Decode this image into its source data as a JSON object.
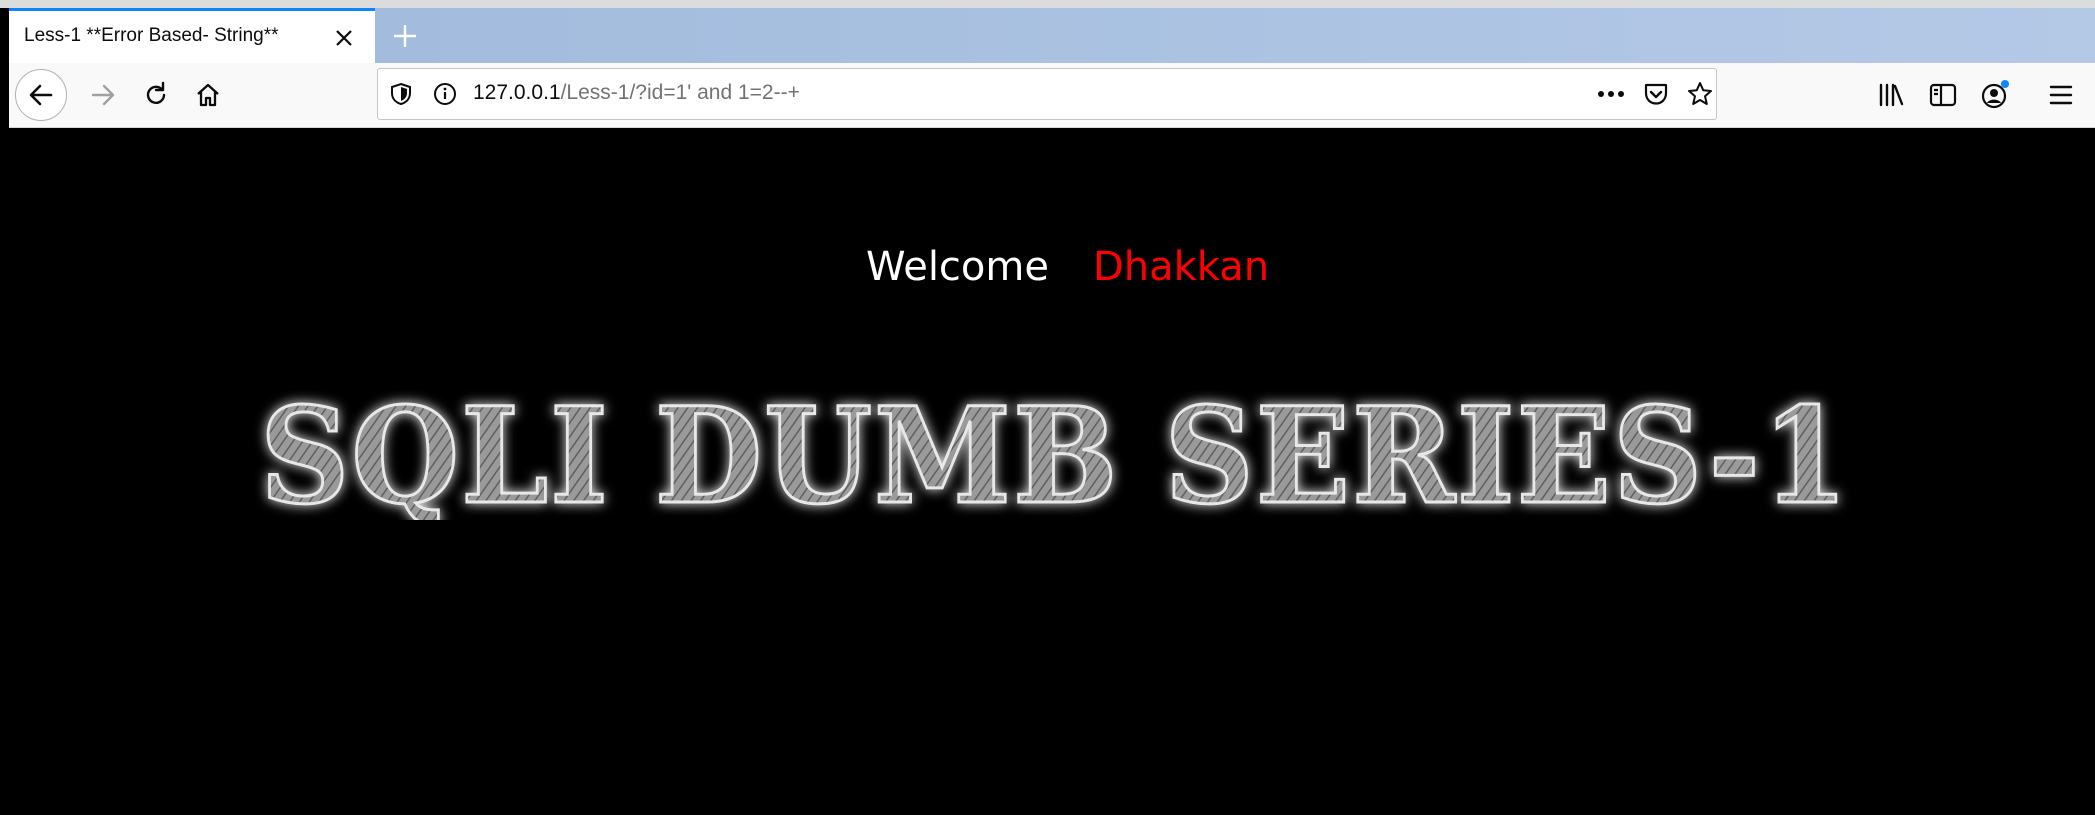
{
  "browser": {
    "tab": {
      "title": "Less-1 **Error Based- String**",
      "close_icon": "close-icon"
    },
    "new_tab_icon": "plus-icon",
    "nav": {
      "back_icon": "back-arrow-icon",
      "forward_icon": "forward-arrow-icon",
      "reload_icon": "reload-icon",
      "home_icon": "home-icon"
    },
    "urlbar": {
      "host": "127.0.0.1",
      "path": "/Less-1/?id=1' and 1=2--+",
      "shield_icon": "tracking-shield-icon",
      "info_icon": "info-icon",
      "more_icon": "more-dots-icon",
      "pocket_icon": "pocket-icon",
      "bookmark_icon": "star-icon"
    },
    "toolbar": {
      "library_icon": "library-icon",
      "sidebar_icon": "sidebar-icon",
      "account_icon": "account-icon",
      "menu_icon": "hamburger-menu-icon"
    },
    "colors": {
      "tab_accent": "#0a84ff",
      "notification_dot": "#0a84ff"
    }
  },
  "page": {
    "welcome_label": "Welcome",
    "welcome_name": "Dhakkan",
    "banner_text": "SQLI DUMB SERIES-1",
    "colors": {
      "background": "#000000",
      "welcome": "#ffffff",
      "name": "#ff0000"
    }
  }
}
